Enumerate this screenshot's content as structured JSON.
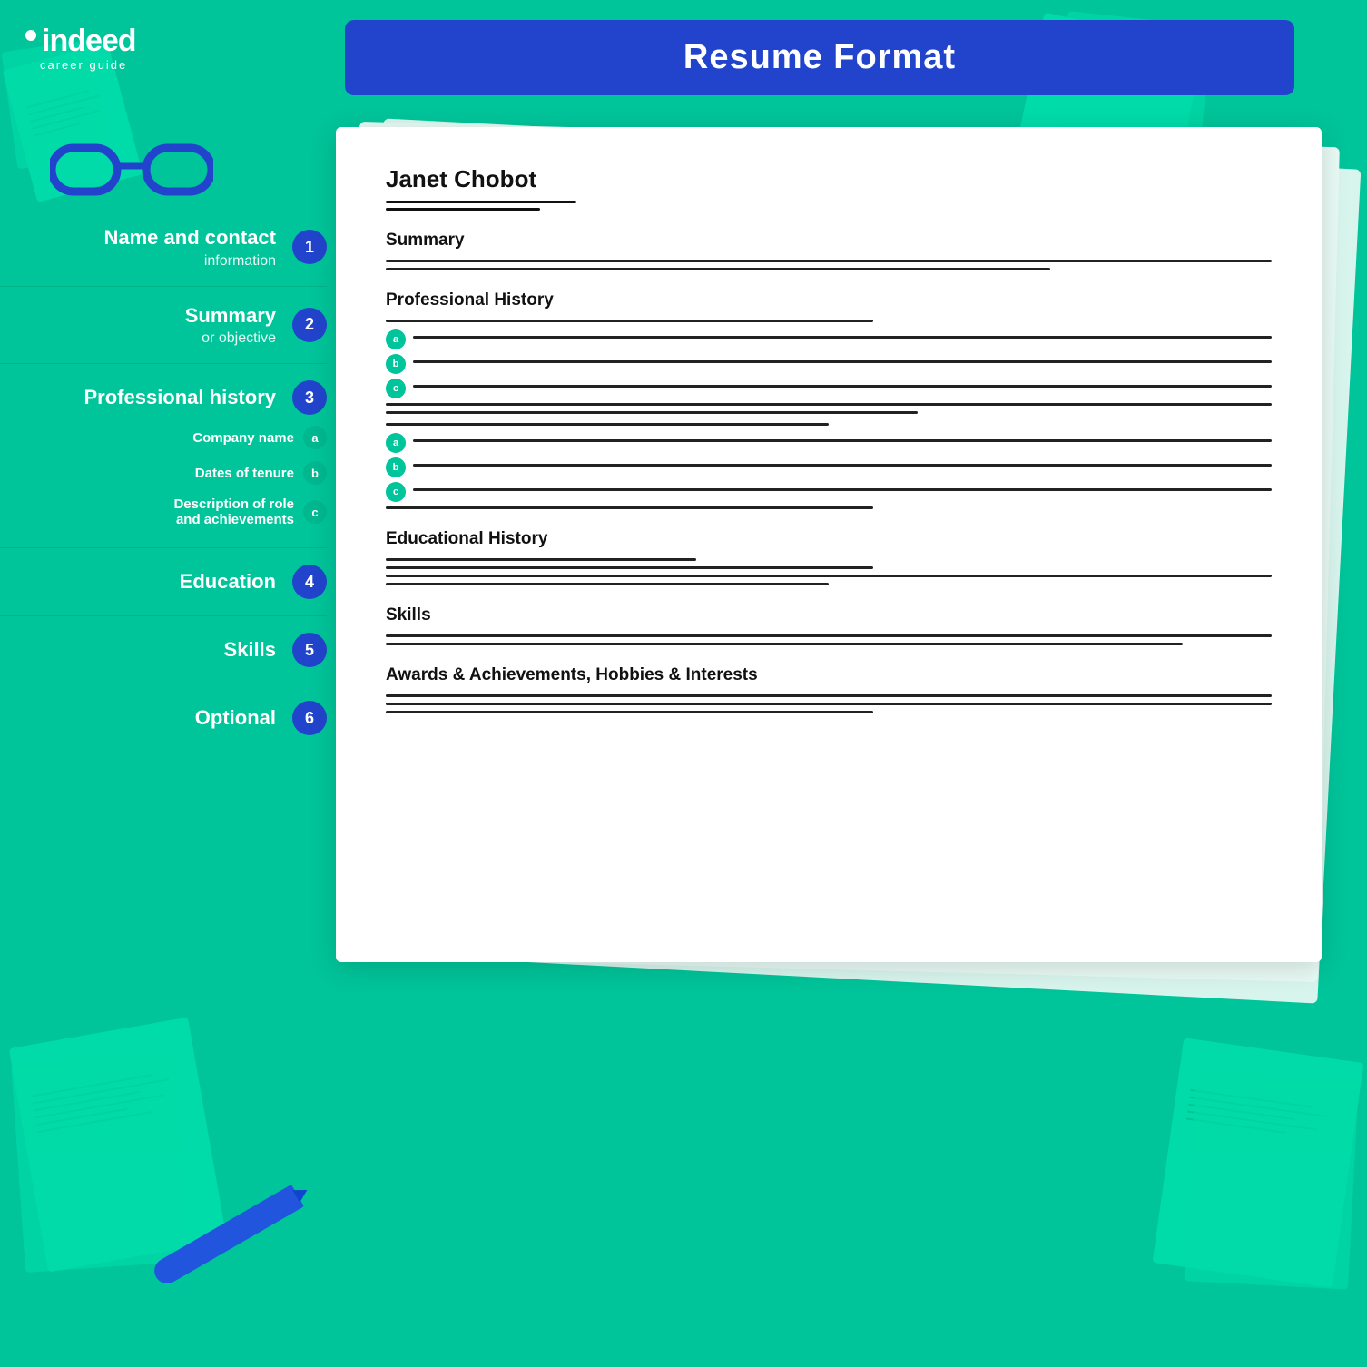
{
  "title": "Resume Format",
  "logo": {
    "brand": "indeed",
    "tagline": "career guide"
  },
  "sidebar": {
    "items": [
      {
        "id": "name-contact",
        "label": "Name and contact",
        "sublabel": "information",
        "badge": "1"
      },
      {
        "id": "summary",
        "label": "Summary",
        "sublabel": "or objective",
        "badge": "2"
      },
      {
        "id": "professional-history",
        "label": "Professional history",
        "badge": "3",
        "subitems": [
          {
            "label": "Company name",
            "badge": "a"
          },
          {
            "label": "Dates of tenure",
            "badge": "b"
          },
          {
            "label": "Description of role",
            "badge": "c",
            "extra": "and achievements"
          }
        ]
      },
      {
        "id": "education",
        "label": "Education",
        "badge": "4"
      },
      {
        "id": "skills",
        "label": "Skills",
        "badge": "5"
      },
      {
        "id": "optional",
        "label": "Optional",
        "badge": "6"
      }
    ]
  },
  "resume": {
    "name": "Janet Chobot",
    "sections": [
      {
        "title": "Summary",
        "type": "text"
      },
      {
        "title": "Professional History",
        "type": "bullets"
      },
      {
        "title": "Educational History",
        "type": "text"
      },
      {
        "title": "Skills",
        "type": "text"
      },
      {
        "title": "Awards & Achievements, Hobbies & Interests",
        "type": "text"
      }
    ]
  },
  "colors": {
    "bg": "#00c49a",
    "accent": "#2244cc",
    "bullet_green": "#00c49a",
    "paper_white": "#ffffff",
    "paper_back1": "#e8faf5",
    "paper_back2": "#d8f5ed"
  }
}
